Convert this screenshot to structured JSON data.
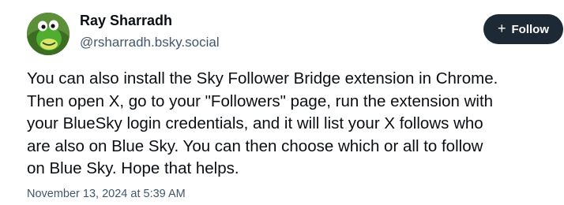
{
  "author": {
    "display_name": "Ray Sharradh",
    "handle": "@rsharradh.bsky.social",
    "avatar_icon": "green-dinosaur-avatar"
  },
  "follow_button": {
    "label": "Follow",
    "icon": "plus-icon"
  },
  "post": {
    "text": "You can also install the Sky Follower Bridge extension in Chrome.\nThen open X, go to your \"Followers\" page, run the extension with\nyour BlueSky login credentials, and it will list your X follows who\nare also on Blue Sky. You can then choose which or all to follow\non Blue Sky. Hope that helps.",
    "timestamp": "November 13, 2024 at 5:39 AM"
  },
  "colors": {
    "follow_button_bg": "#1d2a36",
    "secondary_text": "#42576c",
    "primary_text": "#0b0f14"
  }
}
